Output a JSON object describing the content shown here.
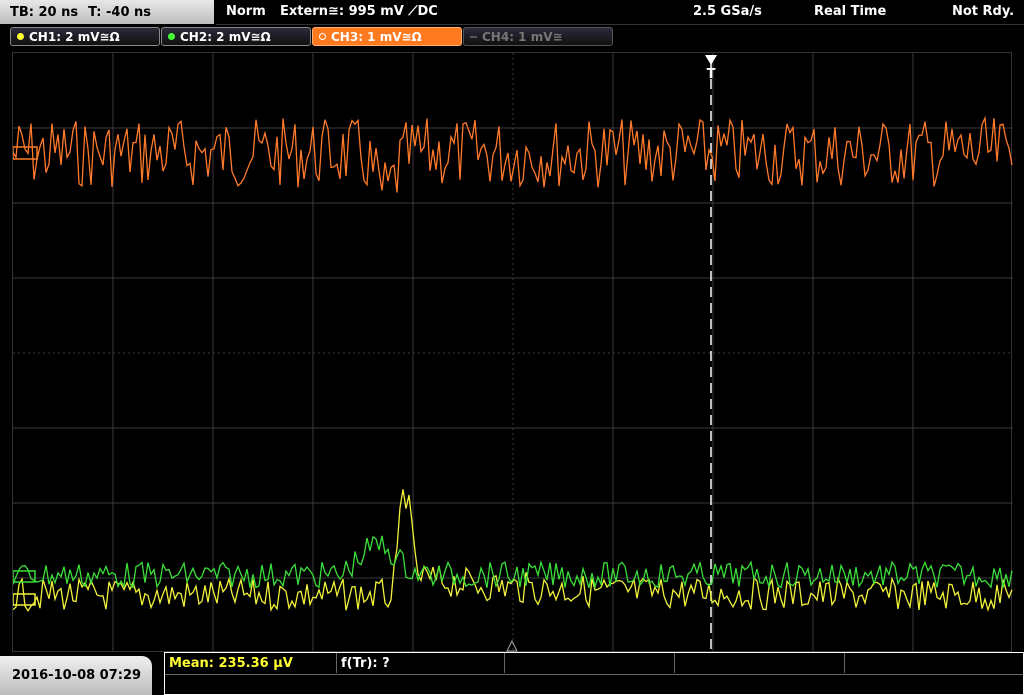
{
  "header": {
    "timebase": "TB: 20 ns",
    "trigger_time": "T: -40 ns",
    "mode": "Norm",
    "trigger_source": "Extern≅: 995 mV ⟋DC",
    "sample_rate": "2.5 GSa/s",
    "acq_mode": "Real Time",
    "state": "Not Rdy."
  },
  "channels": [
    {
      "label": "CH1: 2 mV≅Ω",
      "color": "#ffff33"
    },
    {
      "label": "CH2: 2 mV≅Ω",
      "color": "#44ff33"
    },
    {
      "label": "CH3: 1 mV≅Ω",
      "color": "#ff7a1e"
    },
    {
      "label": "CH4: 1 mV≅",
      "color": "#777777"
    }
  ],
  "trigger_marker": "T",
  "measurements": {
    "mean": "Mean: 235.36 µV",
    "freq": "f(Tr): ?"
  },
  "datetime": "2016-10-08 07:29",
  "colors": {
    "ch1": "#f2f23a",
    "ch2": "#3adf3a",
    "ch3": "#ff7a2a",
    "grid": "#3a3a3a"
  }
}
